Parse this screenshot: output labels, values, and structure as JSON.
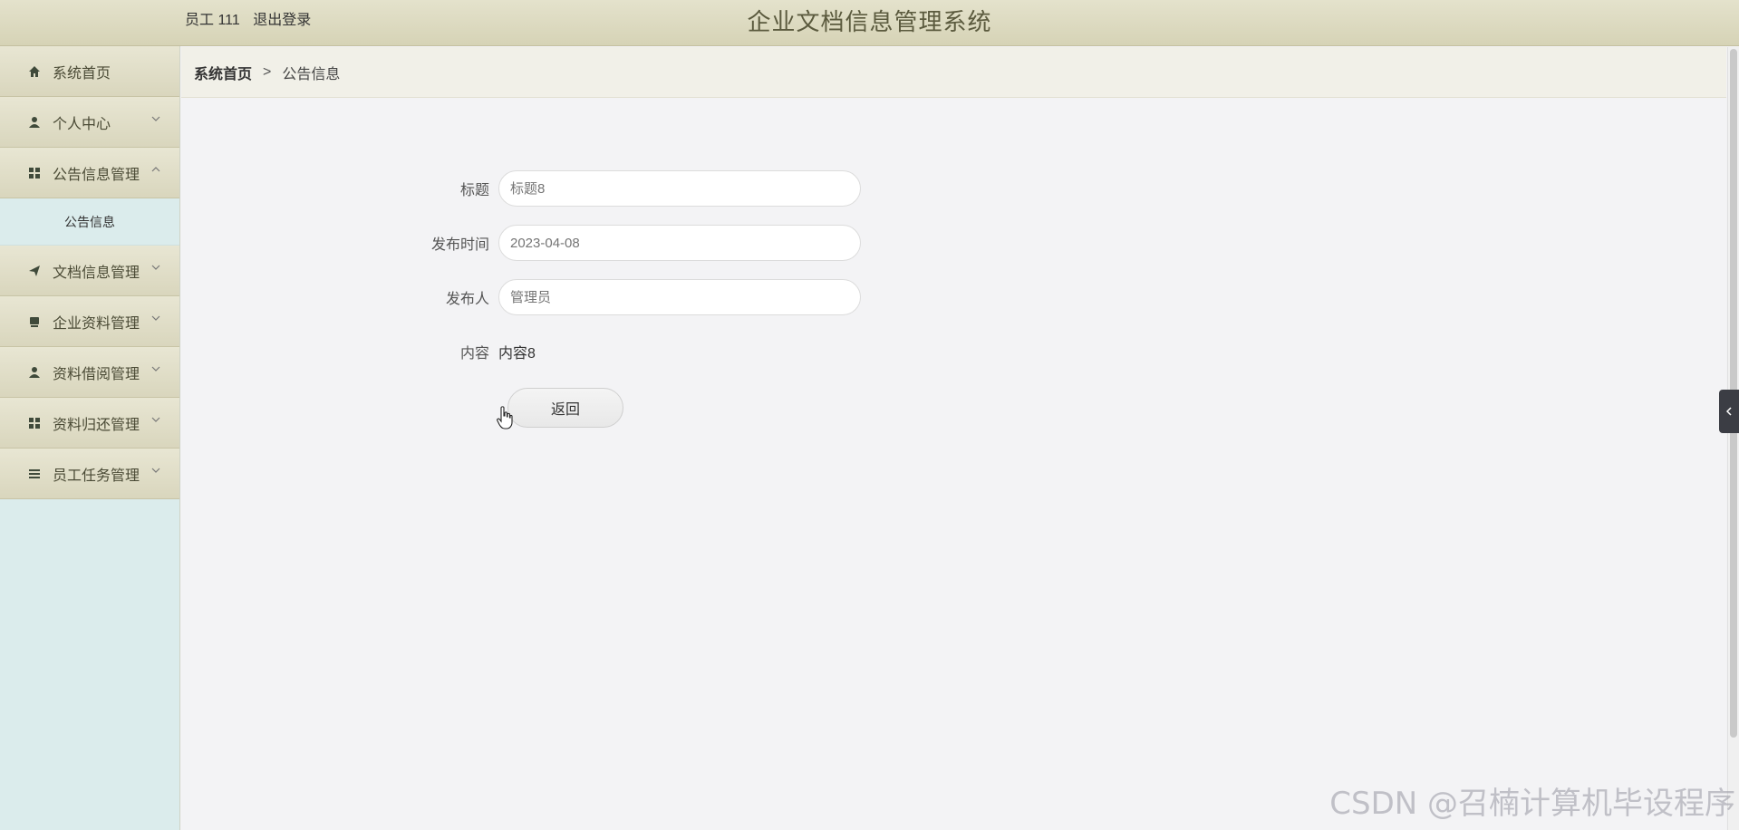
{
  "header": {
    "user_role": "员工 111",
    "logout_label": "退出登录",
    "title": "企业文档信息管理系统"
  },
  "sidebar": {
    "items": [
      {
        "label": "系统首页",
        "icon": "home-icon"
      },
      {
        "label": "个人中心",
        "icon": "user-icon"
      },
      {
        "label": "公告信息管理",
        "icon": "grid-icon",
        "expanded": true
      },
      {
        "label": "文档信息管理",
        "icon": "send-icon"
      },
      {
        "label": "企业资料管理",
        "icon": "box-icon"
      },
      {
        "label": "资料借阅管理",
        "icon": "user-icon"
      },
      {
        "label": "资料归还管理",
        "icon": "grid-icon"
      },
      {
        "label": "员工任务管理",
        "icon": "list-icon"
      }
    ],
    "submenu": {
      "label": "公告信息"
    }
  },
  "breadcrumb": {
    "home": "系统首页",
    "separator": ">",
    "current": "公告信息"
  },
  "form": {
    "title_label": "标题",
    "title_value": "标题8",
    "time_label": "发布时间",
    "time_value": "2023-04-08",
    "publisher_label": "发布人",
    "publisher_value": "管理员",
    "content_label": "内容",
    "content_value": "内容8",
    "back_label": "返回"
  },
  "watermark": "CSDN @召楠计算机毕设程序",
  "colors": {
    "header_bg": "#d9d6bb",
    "sidebar_bg": "#dbecec",
    "menu_bg": "#e0ddc6",
    "title_color": "#5b5a3e"
  }
}
